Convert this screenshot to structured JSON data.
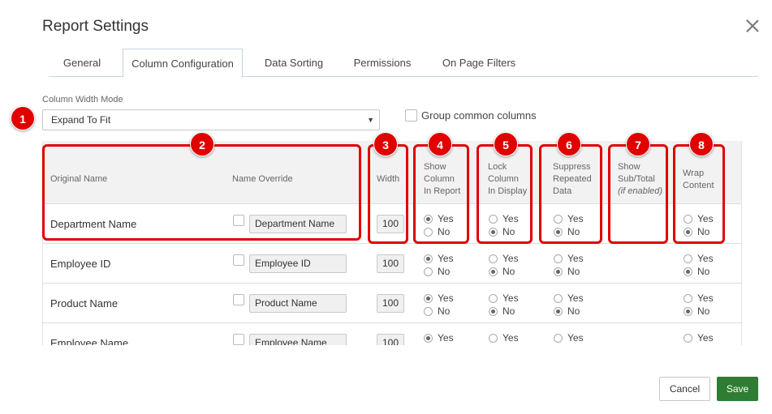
{
  "dialog": {
    "title": "Report Settings"
  },
  "tabs": [
    {
      "label": "General"
    },
    {
      "label": "Column Configuration"
    },
    {
      "label": "Data Sorting"
    },
    {
      "label": "Permissions"
    },
    {
      "label": "On Page Filters"
    }
  ],
  "column_width_mode": {
    "label": "Column Width Mode",
    "value": "Expand To Fit"
  },
  "group_common": {
    "label": "Group common columns",
    "checked": false
  },
  "table": {
    "headers": {
      "original_name": "Original Name",
      "name_override": "Name Override",
      "width": "Width",
      "show_column": [
        "Show",
        "Column",
        "In Report"
      ],
      "lock_column": [
        "Lock",
        "Column",
        "In Display"
      ],
      "suppress": [
        "Suppress",
        "Repeated",
        "Data"
      ],
      "show_subtotal": [
        "Show",
        "Sub/Total",
        "(if enabled)"
      ],
      "wrap": [
        "Wrap",
        "Content"
      ]
    },
    "yes_label": "Yes",
    "no_label": "No",
    "rows": [
      {
        "name": "Department Name",
        "override": "Department Name",
        "width": "100",
        "show": "Yes",
        "lock": "No",
        "suppress": "No",
        "wrap": "No"
      },
      {
        "name": "Employee ID",
        "override": "Employee ID",
        "width": "100",
        "show": "Yes",
        "lock": "No",
        "suppress": "No",
        "wrap": "No"
      },
      {
        "name": "Product Name",
        "override": "Product Name",
        "width": "100",
        "show": "Yes",
        "lock": "No",
        "suppress": "No",
        "wrap": "No"
      },
      {
        "name": "Employee Name",
        "override": "Employee Name",
        "width": "100",
        "show": "Yes",
        "lock": "No",
        "suppress": "No",
        "wrap": "No"
      }
    ]
  },
  "callouts": [
    "1",
    "2",
    "3",
    "4",
    "5",
    "6",
    "7",
    "8"
  ],
  "footer": {
    "cancel": "Cancel",
    "save": "Save"
  },
  "colors": {
    "callout_red": "#e00000",
    "save_green": "#2e7d32"
  }
}
